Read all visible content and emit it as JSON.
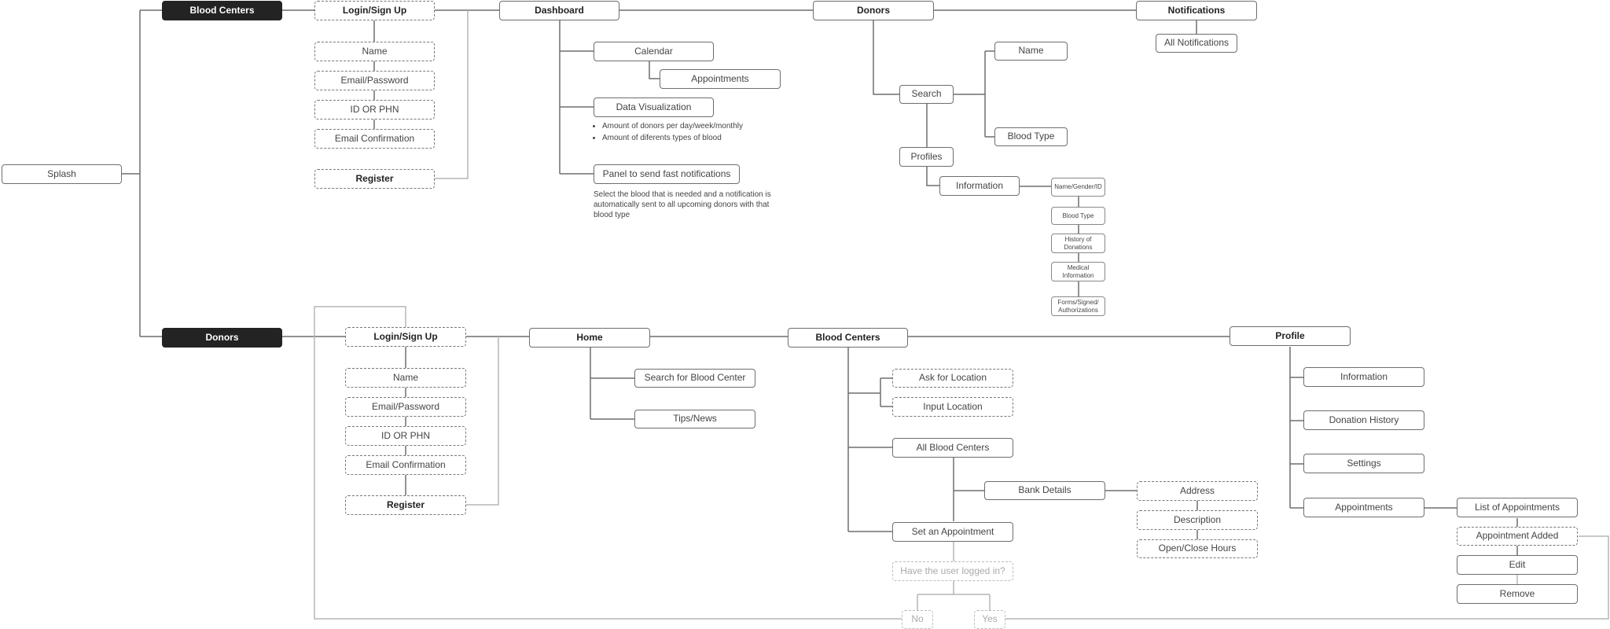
{
  "root": {
    "splash": "Splash"
  },
  "admin": {
    "section": "Blood Centers",
    "auth": {
      "login": "Login/Sign Up",
      "name": "Name",
      "email_password": "Email/Password",
      "id_phn": "ID OR PHN",
      "email_confirmation": "Email Confirmation",
      "register": "Register"
    },
    "dashboard": {
      "title": "Dashboard",
      "calendar": "Calendar",
      "appointments": "Appointments",
      "data_visualization": "Data Visualization",
      "data_viz_notes": [
        "Amount of donors per day/week/monthly",
        "Amount of diferents types of blood"
      ],
      "fast_notifications": "Panel to send fast notifications",
      "fast_notifications_note": "Select the blood that is needed and a notification is automatically sent to all upcoming donors with that blood type"
    },
    "donors": {
      "title": "Donors",
      "search": "Search",
      "search_name": "Name",
      "search_blood_type": "Blood Type",
      "profiles": "Profiles",
      "information": "Information",
      "info_items": [
        "Name/Gender/ID",
        "Blood Type",
        "History of Donations",
        "Medical Information",
        "Forms/Signed/ Authorizations"
      ]
    },
    "notifications": {
      "title": "Notifications",
      "all": "All Notifications"
    }
  },
  "donor": {
    "section": "Donors",
    "auth": {
      "login": "Login/Sign Up",
      "name": "Name",
      "email_password": "Email/Password",
      "id_phn": "ID OR PHN",
      "email_confirmation": "Email Confirmation",
      "register": "Register"
    },
    "home": {
      "title": "Home",
      "search_center": "Search for Blood Center",
      "tips_news": "Tips/News"
    },
    "blood_centers": {
      "title": "Blood Centers",
      "ask_location": "Ask for Location",
      "input_location": "Input Location",
      "all_centers": "All Blood Centers",
      "bank_details": "Bank Details",
      "address": "Address",
      "description": "Description",
      "hours": "Open/Close Hours",
      "set_appointment": "Set an Appointment",
      "logged_in_question": "Have the user logged in?",
      "no": "No",
      "yes": "Yes"
    },
    "profile": {
      "title": "Profile",
      "information": "Information",
      "donation_history": "Donation History",
      "settings": "Settings",
      "appointments": "Appointments",
      "list_appointments": "List of Appointments",
      "appointment_added": "Appointment Added",
      "edit": "Edit",
      "remove": "Remove"
    }
  }
}
